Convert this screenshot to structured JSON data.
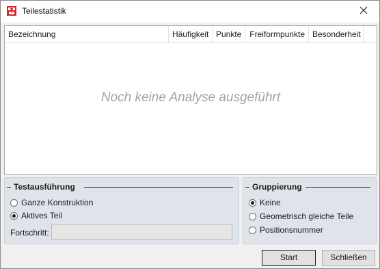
{
  "window": {
    "title": "Teilestatistik",
    "close_icon": "close-icon",
    "app_icon": "teilestatistik-app-icon"
  },
  "list": {
    "columns": [
      {
        "label": "Bezeichnung"
      },
      {
        "label": "Häufigkeit"
      },
      {
        "label": "Punkte"
      },
      {
        "label": "Freiformpunkte"
      },
      {
        "label": "Besonderheit"
      }
    ],
    "empty_message": "Noch keine Analyse ausgeführt"
  },
  "testausfuehrung": {
    "title": "Testausführung",
    "options": [
      {
        "label": "Ganze Konstruktion",
        "checked": false
      },
      {
        "label": "Aktives Teil",
        "checked": true
      }
    ],
    "progress_label": "Fortschritt:",
    "progress_value": 0
  },
  "gruppierung": {
    "title": "Gruppierung",
    "options": [
      {
        "label": "Keine",
        "checked": true
      },
      {
        "label": "Geometrisch gleiche Teile",
        "checked": false
      },
      {
        "label": "Positionsnummer",
        "checked": false
      }
    ]
  },
  "buttons": {
    "start": "Start",
    "close": "Schließen"
  }
}
